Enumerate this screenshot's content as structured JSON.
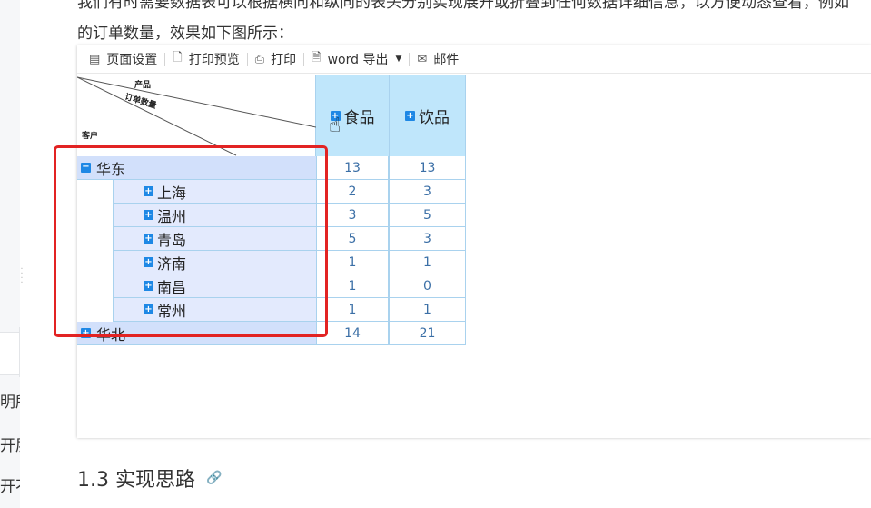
{
  "sidebar": {
    "texts": [
      "明所",
      "开层",
      "开不"
    ]
  },
  "intro": {
    "line1": "我们有时需要数据表可以根据横向和纵向的表头分别实现展开或折叠到任何数据详细信息，以方便动态查看，例如",
    "line2": "的订单数量，效果如下图所示："
  },
  "toolbar": {
    "page_setup": "页面设置",
    "print_preview": "打印预览",
    "print": "打印",
    "word_export": "word 导出",
    "mail": "邮件"
  },
  "table": {
    "corner": {
      "product": "产品",
      "order_count": "订单数量",
      "customer": "客户"
    },
    "columns": [
      "食品",
      "饮品"
    ],
    "rows": [
      {
        "label": "华东",
        "level": "region",
        "expanded": true,
        "values": [
          "13",
          "13"
        ]
      },
      {
        "label": "上海",
        "level": "city",
        "values": [
          "2",
          "3"
        ]
      },
      {
        "label": "温州",
        "level": "city",
        "values": [
          "3",
          "5"
        ]
      },
      {
        "label": "青岛",
        "level": "city",
        "values": [
          "5",
          "3"
        ]
      },
      {
        "label": "济南",
        "level": "city",
        "values": [
          "1",
          "1"
        ]
      },
      {
        "label": "南昌",
        "level": "city",
        "values": [
          "1",
          "0"
        ]
      },
      {
        "label": "常州",
        "level": "city",
        "values": [
          "1",
          "1"
        ]
      },
      {
        "label": "华北",
        "level": "region",
        "expanded": false,
        "values": [
          "14",
          "21"
        ]
      }
    ]
  },
  "section": {
    "title": "1.3 实现思路"
  },
  "colors": {
    "header_bg": "#bfe6fb",
    "region_bg": "#d2e0fb",
    "city_bg": "#e3eafd",
    "highlight": "#e22323",
    "toggle": "#1e88e5"
  }
}
